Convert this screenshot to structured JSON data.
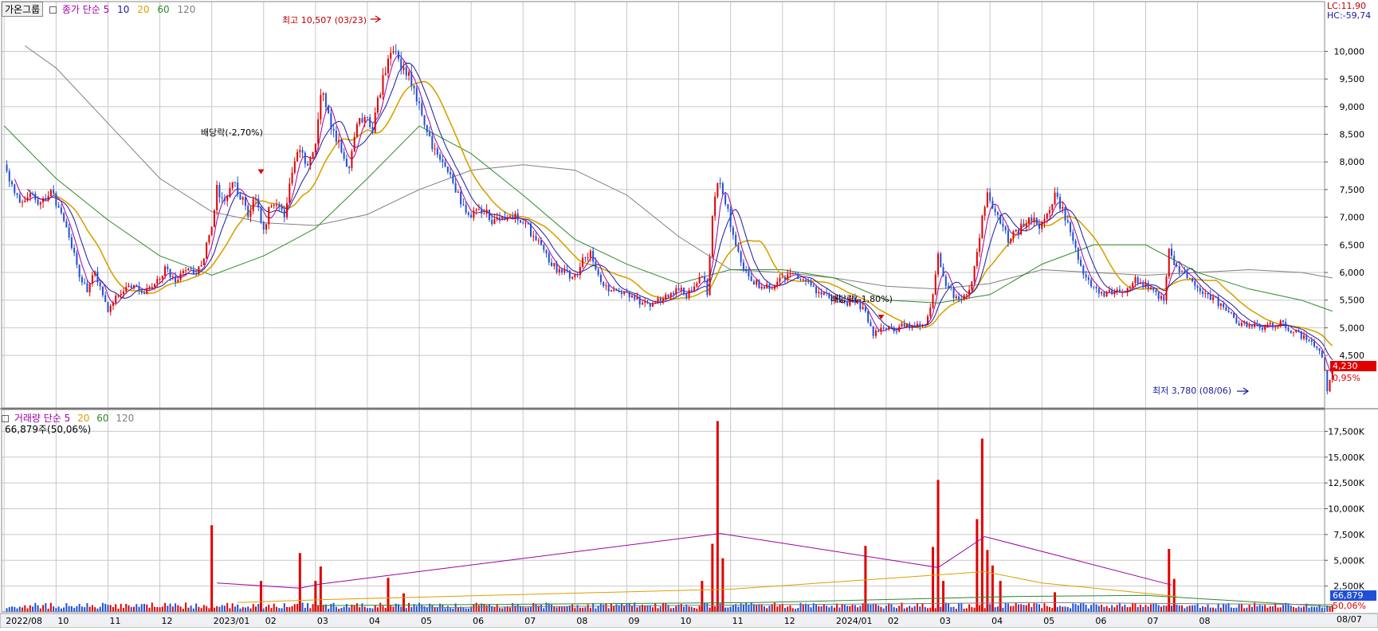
{
  "toolbar": {
    "group_button": "가온그룹",
    "price_legend_label": "종가 단순",
    "ma_periods": [
      "5",
      "10",
      "20",
      "60",
      "120"
    ],
    "volume_legend_label": "거래량 단순",
    "volume_ma_periods": [
      "5",
      "20",
      "60",
      "120"
    ],
    "volume_last_text": "66,879주(50,06%)"
  },
  "colors": {
    "ma5": "#a000a0",
    "ma10": "#1a1aa0",
    "ma20": "#d9a100",
    "ma60": "#2e8b2e",
    "ma120": "#808080",
    "up": "#e00000",
    "down": "#1f4fd6",
    "grid": "#c8c8c8"
  },
  "price_chart": {
    "lc_label": "LC:11,90",
    "hc_label": "HC:-59,74",
    "y_ticks": [
      4500,
      5000,
      5500,
      6000,
      6500,
      7000,
      7500,
      8000,
      8500,
      9000,
      9500,
      10000
    ],
    "y_tick_labels": [
      "4,500",
      "5,000",
      "5,500",
      "6,000",
      "6,500",
      "7,000",
      "7,500",
      "8,000",
      "8,500",
      "9,000",
      "9,500",
      "10,000"
    ],
    "ylim": [
      3550,
      10900
    ],
    "current_price_label": "4,230",
    "current_change_label": "0,95%",
    "current_price": 4230,
    "high_annotation": "최고 10,507 (03/23)",
    "low_annotation": "최저 3,780 (08/06)",
    "dividend_annotations": [
      {
        "label": "배당락(-2,70%)",
        "month_index": 4.95,
        "price": 7780
      },
      {
        "label": "배당락(-1,80%)",
        "month_index": 16.9,
        "price": 5150
      }
    ]
  },
  "volume_chart": {
    "y_ticks": [
      2500,
      5000,
      7500,
      10000,
      12500,
      15000,
      17500
    ],
    "y_tick_labels": [
      "2,500K",
      "5,000K",
      "7,500K",
      "10,000K",
      "12,500K",
      "15,000K",
      "17,500K"
    ],
    "ylim": [
      0,
      19000
    ],
    "current_volume_label": "66,879",
    "current_ratio_label": "50,06%"
  },
  "x_axis": {
    "month_labels": [
      "2022/08",
      "10",
      "11",
      "12",
      "2023/01",
      "02",
      "03",
      "04",
      "05",
      "06",
      "07",
      "08",
      "09",
      "10",
      "11",
      "12",
      "2024/01",
      "02",
      "03",
      "04",
      "05",
      "06",
      "07",
      "08"
    ],
    "right_label": "08/07"
  },
  "chart_data": {
    "type": "candlestick",
    "x_unit": "months since 2022/08 (month index)",
    "price_series": [
      {
        "m": 0.0,
        "c": 7900
      },
      {
        "m": 0.15,
        "c": 7600
      },
      {
        "m": 0.3,
        "c": 7300
      },
      {
        "m": 0.5,
        "c": 7450
      },
      {
        "m": 0.7,
        "c": 7250
      },
      {
        "m": 0.9,
        "c": 7500
      },
      {
        "m": 1.1,
        "c": 7000
      },
      {
        "m": 1.3,
        "c": 6500
      },
      {
        "m": 1.45,
        "c": 5950
      },
      {
        "m": 1.6,
        "c": 5700
      },
      {
        "m": 1.75,
        "c": 6000
      },
      {
        "m": 1.9,
        "c": 5600
      },
      {
        "m": 2.0,
        "c": 5350
      },
      {
        "m": 2.1,
        "c": 5500
      },
      {
        "m": 2.3,
        "c": 5700
      },
      {
        "m": 2.5,
        "c": 5750
      },
      {
        "m": 2.7,
        "c": 5650
      },
      {
        "m": 2.9,
        "c": 5800
      },
      {
        "m": 3.1,
        "c": 6050
      },
      {
        "m": 3.3,
        "c": 5850
      },
      {
        "m": 3.5,
        "c": 6100
      },
      {
        "m": 3.7,
        "c": 5950
      },
      {
        "m": 3.85,
        "c": 6300
      },
      {
        "m": 4.0,
        "c": 6900
      },
      {
        "m": 4.1,
        "c": 7500
      },
      {
        "m": 4.25,
        "c": 7300
      },
      {
        "m": 4.4,
        "c": 7650
      },
      {
        "m": 4.55,
        "c": 7400
      },
      {
        "m": 4.7,
        "c": 7050
      },
      {
        "m": 4.85,
        "c": 7350
      },
      {
        "m": 5.0,
        "c": 6700
      },
      {
        "m": 5.1,
        "c": 7100
      },
      {
        "m": 5.25,
        "c": 7300
      },
      {
        "m": 5.4,
        "c": 7000
      },
      {
        "m": 5.55,
        "c": 7800
      },
      {
        "m": 5.7,
        "c": 8300
      },
      {
        "m": 5.85,
        "c": 7850
      },
      {
        "m": 6.0,
        "c": 8400
      },
      {
        "m": 6.1,
        "c": 9300
      },
      {
        "m": 6.2,
        "c": 9000
      },
      {
        "m": 6.35,
        "c": 8500
      },
      {
        "m": 6.5,
        "c": 8200
      },
      {
        "m": 6.65,
        "c": 7900
      },
      {
        "m": 6.8,
        "c": 8600
      },
      {
        "m": 6.95,
        "c": 8900
      },
      {
        "m": 7.1,
        "c": 8600
      },
      {
        "m": 7.25,
        "c": 9300
      },
      {
        "m": 7.4,
        "c": 9800
      },
      {
        "m": 7.55,
        "c": 10100
      },
      {
        "m": 7.65,
        "c": 9700
      },
      {
        "m": 7.8,
        "c": 9600
      },
      {
        "m": 7.95,
        "c": 9100
      },
      {
        "m": 8.1,
        "c": 8700
      },
      {
        "m": 8.25,
        "c": 8300
      },
      {
        "m": 8.4,
        "c": 8050
      },
      {
        "m": 8.55,
        "c": 7800
      },
      {
        "m": 8.7,
        "c": 7450
      },
      {
        "m": 8.85,
        "c": 7200
      },
      {
        "m": 9.0,
        "c": 7000
      },
      {
        "m": 9.2,
        "c": 7150
      },
      {
        "m": 9.4,
        "c": 6950
      },
      {
        "m": 9.6,
        "c": 7000
      },
      {
        "m": 9.8,
        "c": 7050
      },
      {
        "m": 10.0,
        "c": 6950
      },
      {
        "m": 10.2,
        "c": 6650
      },
      {
        "m": 10.4,
        "c": 6350
      },
      {
        "m": 10.6,
        "c": 6100
      },
      {
        "m": 10.8,
        "c": 6000
      },
      {
        "m": 11.0,
        "c": 5900
      },
      {
        "m": 11.15,
        "c": 6200
      },
      {
        "m": 11.3,
        "c": 6400
      },
      {
        "m": 11.45,
        "c": 6000
      },
      {
        "m": 11.6,
        "c": 5700
      },
      {
        "m": 11.8,
        "c": 5650
      },
      {
        "m": 12.0,
        "c": 5600
      },
      {
        "m": 12.2,
        "c": 5500
      },
      {
        "m": 12.4,
        "c": 5400
      },
      {
        "m": 12.6,
        "c": 5500
      },
      {
        "m": 12.8,
        "c": 5600
      },
      {
        "m": 13.0,
        "c": 5700
      },
      {
        "m": 13.15,
        "c": 5600
      },
      {
        "m": 13.3,
        "c": 5750
      },
      {
        "m": 13.45,
        "c": 5950
      },
      {
        "m": 13.55,
        "c": 5650
      },
      {
        "m": 13.65,
        "c": 7000
      },
      {
        "m": 13.75,
        "c": 7700
      },
      {
        "m": 13.85,
        "c": 7400
      },
      {
        "m": 13.95,
        "c": 7200
      },
      {
        "m": 14.05,
        "c": 6600
      },
      {
        "m": 14.2,
        "c": 6200
      },
      {
        "m": 14.4,
        "c": 5900
      },
      {
        "m": 14.6,
        "c": 5700
      },
      {
        "m": 14.8,
        "c": 5750
      },
      {
        "m": 15.0,
        "c": 5900
      },
      {
        "m": 15.2,
        "c": 5950
      },
      {
        "m": 15.4,
        "c": 5850
      },
      {
        "m": 15.6,
        "c": 5700
      },
      {
        "m": 15.8,
        "c": 5600
      },
      {
        "m": 16.0,
        "c": 5500
      },
      {
        "m": 16.2,
        "c": 5450
      },
      {
        "m": 16.4,
        "c": 5500
      },
      {
        "m": 16.6,
        "c": 5300
      },
      {
        "m": 16.75,
        "c": 4900
      },
      {
        "m": 16.95,
        "c": 5000
      },
      {
        "m": 17.15,
        "c": 4950
      },
      {
        "m": 17.35,
        "c": 5050
      },
      {
        "m": 17.55,
        "c": 5000
      },
      {
        "m": 17.75,
        "c": 5050
      },
      {
        "m": 17.9,
        "c": 5600
      },
      {
        "m": 18.0,
        "c": 6300
      },
      {
        "m": 18.15,
        "c": 5800
      },
      {
        "m": 18.3,
        "c": 5600
      },
      {
        "m": 18.45,
        "c": 5500
      },
      {
        "m": 18.6,
        "c": 5700
      },
      {
        "m": 18.75,
        "c": 6300
      },
      {
        "m": 18.85,
        "c": 7000
      },
      {
        "m": 18.95,
        "c": 7400
      },
      {
        "m": 19.05,
        "c": 7200
      },
      {
        "m": 19.2,
        "c": 6900
      },
      {
        "m": 19.35,
        "c": 6600
      },
      {
        "m": 19.5,
        "c": 6700
      },
      {
        "m": 19.65,
        "c": 6900
      },
      {
        "m": 19.8,
        "c": 7000
      },
      {
        "m": 19.95,
        "c": 6800
      },
      {
        "m": 20.1,
        "c": 7000
      },
      {
        "m": 20.25,
        "c": 7400
      },
      {
        "m": 20.4,
        "c": 7100
      },
      {
        "m": 20.55,
        "c": 6800
      },
      {
        "m": 20.7,
        "c": 6300
      },
      {
        "m": 20.85,
        "c": 5900
      },
      {
        "m": 21.0,
        "c": 5700
      },
      {
        "m": 21.2,
        "c": 5600
      },
      {
        "m": 21.4,
        "c": 5650
      },
      {
        "m": 21.6,
        "c": 5700
      },
      {
        "m": 21.8,
        "c": 5850
      },
      {
        "m": 22.0,
        "c": 5750
      },
      {
        "m": 22.2,
        "c": 5600
      },
      {
        "m": 22.35,
        "c": 5550
      },
      {
        "m": 22.45,
        "c": 6400
      },
      {
        "m": 22.6,
        "c": 6100
      },
      {
        "m": 22.8,
        "c": 5900
      },
      {
        "m": 23.0,
        "c": 5750
      },
      {
        "m": 23.2,
        "c": 5600
      },
      {
        "m": 23.4,
        "c": 5450
      },
      {
        "m": 23.6,
        "c": 5250
      },
      {
        "m": 23.8,
        "c": 5100
      },
      {
        "m": 24.0,
        "c": 5050
      },
      {
        "m": 24.2,
        "c": 5000
      },
      {
        "m": 24.4,
        "c": 5050
      },
      {
        "m": 24.6,
        "c": 5100
      },
      {
        "m": 24.8,
        "c": 4950
      },
      {
        "m": 25.0,
        "c": 4850
      },
      {
        "m": 25.15,
        "c": 4750
      },
      {
        "m": 25.3,
        "c": 4650
      },
      {
        "m": 25.4,
        "c": 4500
      },
      {
        "m": 25.5,
        "c": 3900
      },
      {
        "m": 25.6,
        "c": 4230
      }
    ],
    "volume_spikes_k": [
      {
        "m": 4.0,
        "v": 8400
      },
      {
        "m": 4.95,
        "v": 3000
      },
      {
        "m": 5.7,
        "v": 5700
      },
      {
        "m": 6.0,
        "v": 3000
      },
      {
        "m": 6.1,
        "v": 4400
      },
      {
        "m": 7.4,
        "v": 3300
      },
      {
        "m": 7.7,
        "v": 1800
      },
      {
        "m": 13.45,
        "v": 3000
      },
      {
        "m": 13.65,
        "v": 6600
      },
      {
        "m": 13.75,
        "v": 18500
      },
      {
        "m": 13.85,
        "v": 5200
      },
      {
        "m": 16.6,
        "v": 6400
      },
      {
        "m": 17.9,
        "v": 6300
      },
      {
        "m": 18.0,
        "v": 12800
      },
      {
        "m": 18.1,
        "v": 3000
      },
      {
        "m": 18.75,
        "v": 9000
      },
      {
        "m": 18.85,
        "v": 16800
      },
      {
        "m": 18.95,
        "v": 6000
      },
      {
        "m": 19.05,
        "v": 4500
      },
      {
        "m": 19.2,
        "v": 3000
      },
      {
        "m": 20.25,
        "v": 1900
      },
      {
        "m": 22.45,
        "v": 6100
      },
      {
        "m": 22.55,
        "v": 3200
      }
    ],
    "ma120_price": [
      {
        "m": 0.4,
        "v": 10100
      },
      {
        "m": 1.0,
        "v": 9700
      },
      {
        "m": 2.0,
        "v": 8700
      },
      {
        "m": 3.0,
        "v": 7700
      },
      {
        "m": 4.0,
        "v": 7100
      },
      {
        "m": 5.0,
        "v": 6900
      },
      {
        "m": 6.0,
        "v": 6850
      },
      {
        "m": 7.0,
        "v": 7050
      },
      {
        "m": 8.0,
        "v": 7500
      },
      {
        "m": 9.0,
        "v": 7850
      },
      {
        "m": 10.0,
        "v": 7950
      },
      {
        "m": 11.0,
        "v": 7850
      },
      {
        "m": 12.0,
        "v": 7400
      },
      {
        "m": 13.0,
        "v": 6650
      },
      {
        "m": 14.0,
        "v": 6050
      },
      {
        "m": 15.0,
        "v": 6000
      },
      {
        "m": 16.0,
        "v": 5900
      },
      {
        "m": 17.0,
        "v": 5750
      },
      {
        "m": 18.0,
        "v": 5700
      },
      {
        "m": 19.0,
        "v": 5800
      },
      {
        "m": 20.0,
        "v": 6050
      },
      {
        "m": 21.0,
        "v": 6000
      },
      {
        "m": 22.0,
        "v": 5950
      },
      {
        "m": 23.0,
        "v": 6000
      },
      {
        "m": 24.0,
        "v": 6050
      },
      {
        "m": 25.0,
        "v": 6000
      },
      {
        "m": 25.6,
        "v": 5900
      }
    ],
    "ma60_price": [
      {
        "m": 0.0,
        "v": 8650
      },
      {
        "m": 1.0,
        "v": 7700
      },
      {
        "m": 2.0,
        "v": 6950
      },
      {
        "m": 3.0,
        "v": 6300
      },
      {
        "m": 4.0,
        "v": 5950
      },
      {
        "m": 5.0,
        "v": 6300
      },
      {
        "m": 6.0,
        "v": 6800
      },
      {
        "m": 7.0,
        "v": 7700
      },
      {
        "m": 8.0,
        "v": 8650
      },
      {
        "m": 9.0,
        "v": 8150
      },
      {
        "m": 10.0,
        "v": 7400
      },
      {
        "m": 11.0,
        "v": 6600
      },
      {
        "m": 12.0,
        "v": 6150
      },
      {
        "m": 13.0,
        "v": 5800
      },
      {
        "m": 14.0,
        "v": 6050
      },
      {
        "m": 15.0,
        "v": 6050
      },
      {
        "m": 16.0,
        "v": 5900
      },
      {
        "m": 17.0,
        "v": 5500
      },
      {
        "m": 18.0,
        "v": 5450
      },
      {
        "m": 19.0,
        "v": 5600
      },
      {
        "m": 20.0,
        "v": 6150
      },
      {
        "m": 21.0,
        "v": 6500
      },
      {
        "m": 22.0,
        "v": 6500
      },
      {
        "m": 23.0,
        "v": 6000
      },
      {
        "m": 24.0,
        "v": 5700
      },
      {
        "m": 25.0,
        "v": 5500
      },
      {
        "m": 25.6,
        "v": 5300
      }
    ],
    "volume_ma_levels_k": {
      "ma5": [
        {
          "m": 4.1,
          "v": 2800
        },
        {
          "m": 5.7,
          "v": 2300
        },
        {
          "m": 6.1,
          "v": 2700
        },
        {
          "m": 13.8,
          "v": 7600
        },
        {
          "m": 18.0,
          "v": 4300
        },
        {
          "m": 18.9,
          "v": 7300
        },
        {
          "m": 22.5,
          "v": 2600
        }
      ],
      "ma20": [
        {
          "m": 4.5,
          "v": 900
        },
        {
          "m": 6.2,
          "v": 1200
        },
        {
          "m": 14.0,
          "v": 2200
        },
        {
          "m": 18.9,
          "v": 3900
        },
        {
          "m": 20.0,
          "v": 2800
        },
        {
          "m": 22.6,
          "v": 1500
        }
      ],
      "ma60": [
        {
          "m": 6.0,
          "v": 600
        },
        {
          "m": 14.5,
          "v": 900
        },
        {
          "m": 19.5,
          "v": 1500
        },
        {
          "m": 22.0,
          "v": 1600
        },
        {
          "m": 25.6,
          "v": 500
        }
      ],
      "ma120": [
        {
          "m": 8.0,
          "v": 400
        },
        {
          "m": 15.0,
          "v": 700
        },
        {
          "m": 20.0,
          "v": 900
        },
        {
          "m": 25.6,
          "v": 700
        }
      ]
    }
  }
}
